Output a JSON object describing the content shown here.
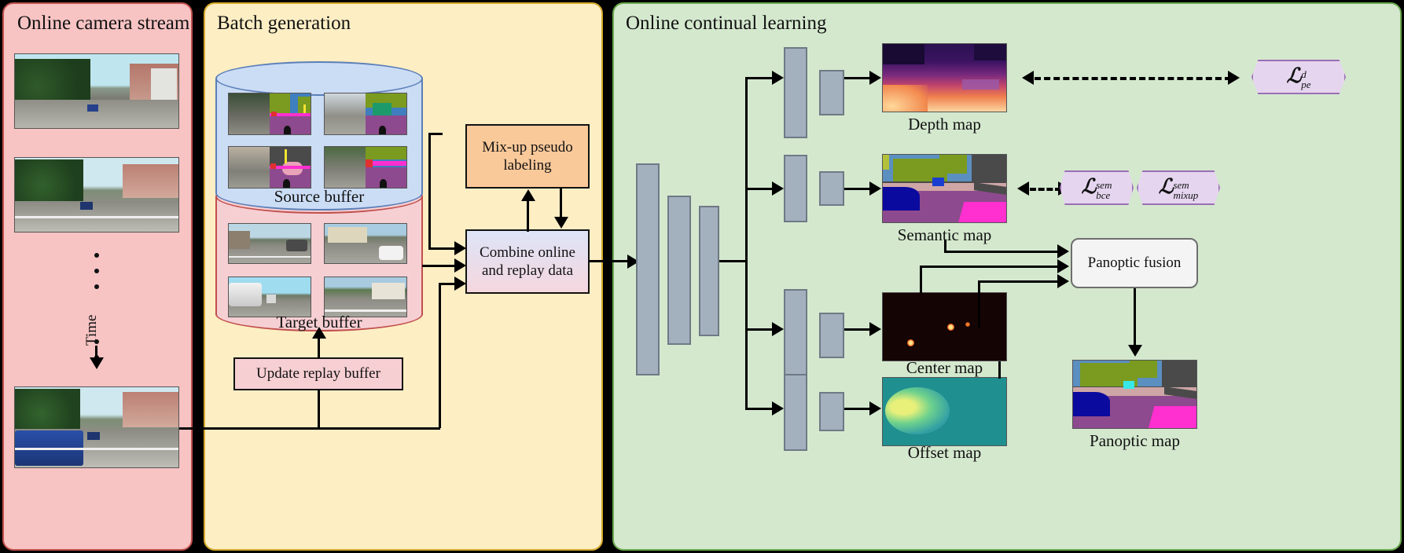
{
  "panels": {
    "stream": {
      "title": "Online camera stream",
      "bg": "#f7c3c3",
      "border": "#c0504d",
      "time_label": "Time"
    },
    "batch": {
      "title": "Batch generation",
      "bg": "#fdeec4",
      "border": "#d6a92c"
    },
    "ocl": {
      "title": "Online continual learning",
      "bg": "#d4e8ce",
      "border": "#6aa84f"
    }
  },
  "batch": {
    "source_buffer_label": "Source buffer",
    "target_buffer_label": "Target buffer",
    "source_buffer_color": "#cbdcf5",
    "target_buffer_color": "#f6cfd3",
    "mixup_box": {
      "label_line1": "Mix-up pseudo",
      "label_line2": "labeling",
      "color": "#fac99a"
    },
    "combine_box": {
      "label_line1": "Combine online",
      "label_line2": "and replay data",
      "color_from": "#dde4f7",
      "color_to": "#f5d7de"
    },
    "update_box": {
      "label": "Update replay buffer",
      "color": "#f6cfd3"
    }
  },
  "ocl": {
    "maps": [
      {
        "name": "depth",
        "label": "Depth map"
      },
      {
        "name": "semantic",
        "label": "Semantic map"
      },
      {
        "name": "center",
        "label": "Center map"
      },
      {
        "name": "offset",
        "label": "Offset map"
      }
    ],
    "fusion_box": {
      "label": "Panoptic fusion",
      "color": "#f4f4f4"
    },
    "panoptic_label": "Panoptic map",
    "losses": [
      {
        "name": "depth-photometric",
        "symbol": "L",
        "sup": "d",
        "sub": "pe"
      },
      {
        "name": "semantic-bce",
        "symbol": "L",
        "sup": "sem",
        "sub": "bce"
      },
      {
        "name": "semantic-mixup",
        "symbol": "L",
        "sup": "sem",
        "sub": "mixup"
      }
    ],
    "loss_color": "#e5d5ef",
    "loss_border": "#9b6fb5",
    "encoder_bar_color": "#a3b0bd"
  }
}
